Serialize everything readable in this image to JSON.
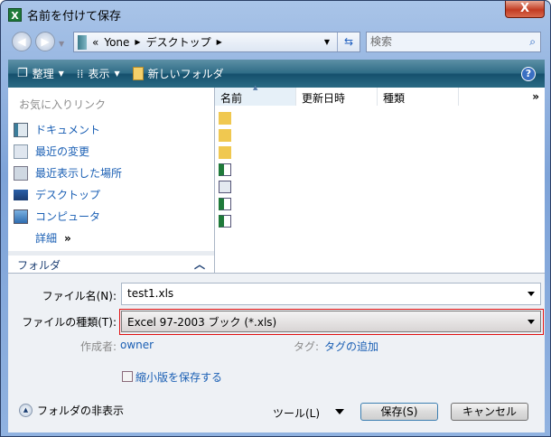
{
  "window": {
    "title": "名前を付けて保存",
    "close": "X"
  },
  "address": {
    "overflow": "«",
    "crumbs": [
      "Yone",
      "デスクトップ"
    ],
    "search_placeholder": "検索"
  },
  "toolbar": {
    "organize": "整理",
    "views": "表示",
    "new_folder": "新しいフォルダ",
    "help": "?"
  },
  "favorites": {
    "header": "お気に入りリンク",
    "items": [
      "ドキュメント",
      "最近の変更",
      "最近表示した場所",
      "デスクトップ",
      "コンピュータ"
    ],
    "more": "詳細",
    "more_glyph": "»"
  },
  "folders": {
    "label": "フォルダ"
  },
  "columns": [
    "名前",
    "更新日時",
    "種類"
  ],
  "columns_more": "»",
  "form": {
    "filename_label": "ファイル名(N):",
    "filename_value": "test1.xls",
    "type_label": "ファイルの種類(T):",
    "type_value": "Excel 97-2003 ブック (*.xls)",
    "author_label": "作成者:",
    "author_value": "owner",
    "tags_label": "タグ:",
    "tags_value": "タグの追加",
    "thumbnail_label": "縮小版を保存する"
  },
  "footer": {
    "hide_folders": "フォルダの非表示",
    "tools": "ツール(L)",
    "save": "保存(S)",
    "cancel": "キャンセル"
  }
}
